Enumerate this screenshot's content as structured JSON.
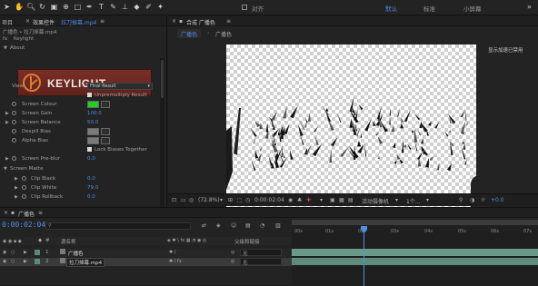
{
  "toolbar": {
    "workspaces": [
      "默认",
      "标准",
      "小屏幕"
    ],
    "snap_label": "对齐"
  },
  "effects_panel": {
    "tab_project": "项目",
    "tab_label": "效果控件",
    "tab_file": "拉刀掉幕.mp4",
    "breadcrumb": "广播色 • 拉刀掉幕.mp4",
    "effect_name": "Keylight",
    "about_label": "About",
    "logo_text": "KEYLIGHT",
    "view_label": "View",
    "view_value": "Final Result",
    "unpremultiply_label": "Unpremultiply Result",
    "screen_colour_label": "Screen Colour",
    "screen_colour": "#22d022",
    "screen_gain_label": "Screen Gain",
    "screen_gain_value": "100.0",
    "screen_balance_label": "Screen Balance",
    "screen_balance_value": "50.0",
    "despill_bias_label": "Despill Bias",
    "alpha_bias_label": "Alpha Bias",
    "lock_biases_label": "Lock Biases Together",
    "screen_preblur_label": "Screen Pre-blur",
    "screen_preblur_value": "0.0",
    "screen_matte_label": "Screen Matte",
    "clip_black_label": "Clip Black",
    "clip_black_value": "0.0",
    "clip_white_label": "Clip White",
    "clip_white_value": "79.0",
    "clip_rollback_label": "Clip Rollback",
    "clip_rollback_value": "0.0"
  },
  "comp_panel": {
    "tab_label": "合成 广播色",
    "subtab_active": "广播色",
    "subtab_inactive": "广播色",
    "display_note": "显示加速已禁用",
    "zoom": "(72.8%)",
    "timecode": "0:00:02:04",
    "camera": "活动摄像机",
    "views": "1个...",
    "exposure": "+0.0"
  },
  "timeline": {
    "tab_label": "广播色",
    "current_time": "0:00:02:04",
    "search_placeholder": "",
    "col_source": "源名称",
    "col_parent": "父级和链接",
    "ruler": [
      "00s",
      "01s",
      "02s",
      "03s",
      "04s",
      "05s",
      "06s",
      "07s"
    ],
    "layers": [
      {
        "num": "1",
        "name": "广播色",
        "parent": "无",
        "color": "#5a8a7a"
      },
      {
        "num": "2",
        "name": "拉刀掉幕.mp4",
        "parent": "无",
        "color": "#5a8a7a"
      }
    ]
  }
}
